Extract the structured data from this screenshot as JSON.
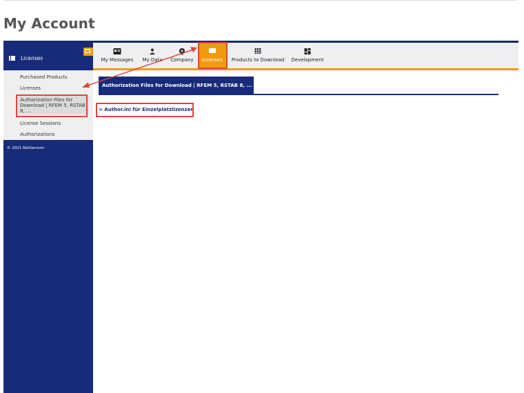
{
  "page": {
    "title": "My Account"
  },
  "sidebar": {
    "header_label": "Licenses",
    "items": [
      {
        "label": "Purchased Products"
      },
      {
        "label": "Licenses"
      },
      {
        "label": "Authorization Files for Download | RFEM 5, RSTAB 8, ..."
      },
      {
        "label": "License Sessions"
      },
      {
        "label": "Authorizations"
      }
    ],
    "copyright": "© 2021 NetGenium"
  },
  "topnav": {
    "items": [
      {
        "label": "My Messages",
        "icon": "id-card-icon"
      },
      {
        "label": "My Data",
        "icon": "user-icon"
      },
      {
        "label": "Company",
        "icon": "map-pin-icon"
      },
      {
        "label": "Licenses",
        "icon": "license-icon",
        "active": true
      },
      {
        "label": "Products to Download",
        "icon": "grid-icon"
      },
      {
        "label": "Development",
        "icon": "dashboard-icon"
      }
    ]
  },
  "content": {
    "tab_label": "Authorization Files for Download | RFEM 5, RSTAB 8, ...",
    "link_text": "> Author.ini für Einzelplatzlizenzen"
  },
  "colors": {
    "navy": "#172b78",
    "orange": "#f29a0f",
    "annotation_red": "#e0453a"
  }
}
